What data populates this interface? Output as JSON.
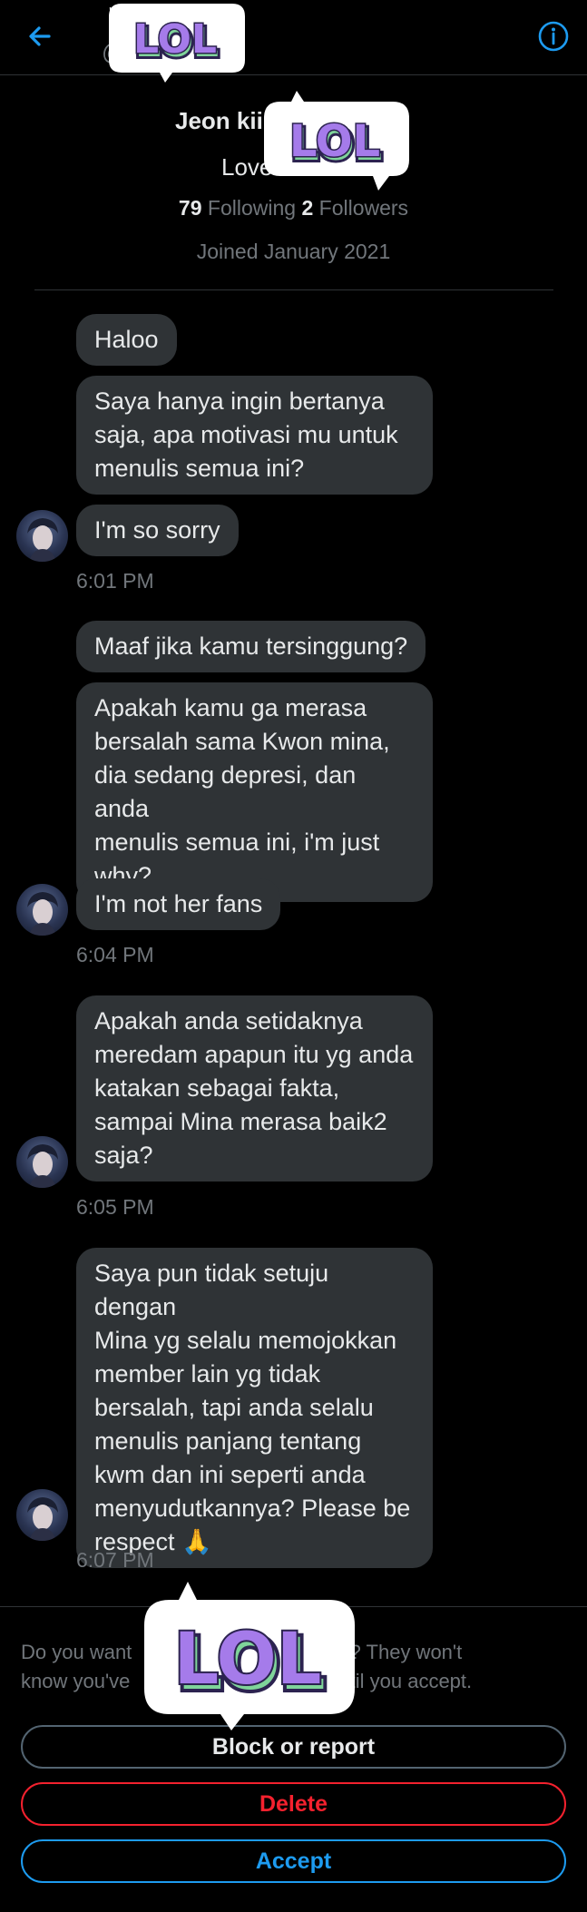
{
  "header": {
    "handle_prefix": "@",
    "back_icon": "arrow-left-icon",
    "info_icon": "info-icon",
    "accent": "#1d9bf0"
  },
  "profile": {
    "name": "Jeon kii",
    "bio": "Love",
    "following_count": "79",
    "following_label": "Following",
    "followers_count": "2",
    "followers_label": "Followers",
    "joined": "Joined January 2021"
  },
  "messages": [
    {
      "text": "Haloo"
    },
    {
      "text": "Saya hanya ingin bertanya\nsaja, apa motivasi mu untuk\nmenulis semua ini?"
    },
    {
      "text": "I'm so sorry"
    },
    {
      "time": "6:01 PM"
    },
    {
      "text": "Maaf jika kamu tersinggung?"
    },
    {
      "text": "Apakah kamu ga merasa\nbersalah sama Kwon mina,\ndia sedang depresi, dan anda\nmenulis semua ini, i'm just\nwhy?"
    },
    {
      "text": "I'm not her fans"
    },
    {
      "time": "6:04 PM"
    },
    {
      "text": "Apakah anda setidaknya\nmeredam apapun itu yg anda\nkatakan sebagai fakta,\nsampai Mina merasa baik2\nsaja?"
    },
    {
      "time": "6:05 PM"
    },
    {
      "text": "Saya pun tidak setuju dengan\nMina yg selalu memojokkan\nmember lain yg tidak\nbersalah, tapi anda selalu\nmenulis panjang tentang\nkwm dan ini seperti anda\nmenyudutkannya? Please be\nrespect 🙏"
    },
    {
      "time": "6:07 PM"
    }
  ],
  "request": {
    "notice_part1": "Do you want",
    "notice_part2": "age you? They won't",
    "notice_part3": "know you've",
    "notice_part4": "ntil you accept.",
    "block_label": "Block or report",
    "delete_label": "Delete",
    "accept_label": "Accept",
    "danger_color": "#f4212e"
  },
  "stickers": {
    "text": "LOL"
  }
}
